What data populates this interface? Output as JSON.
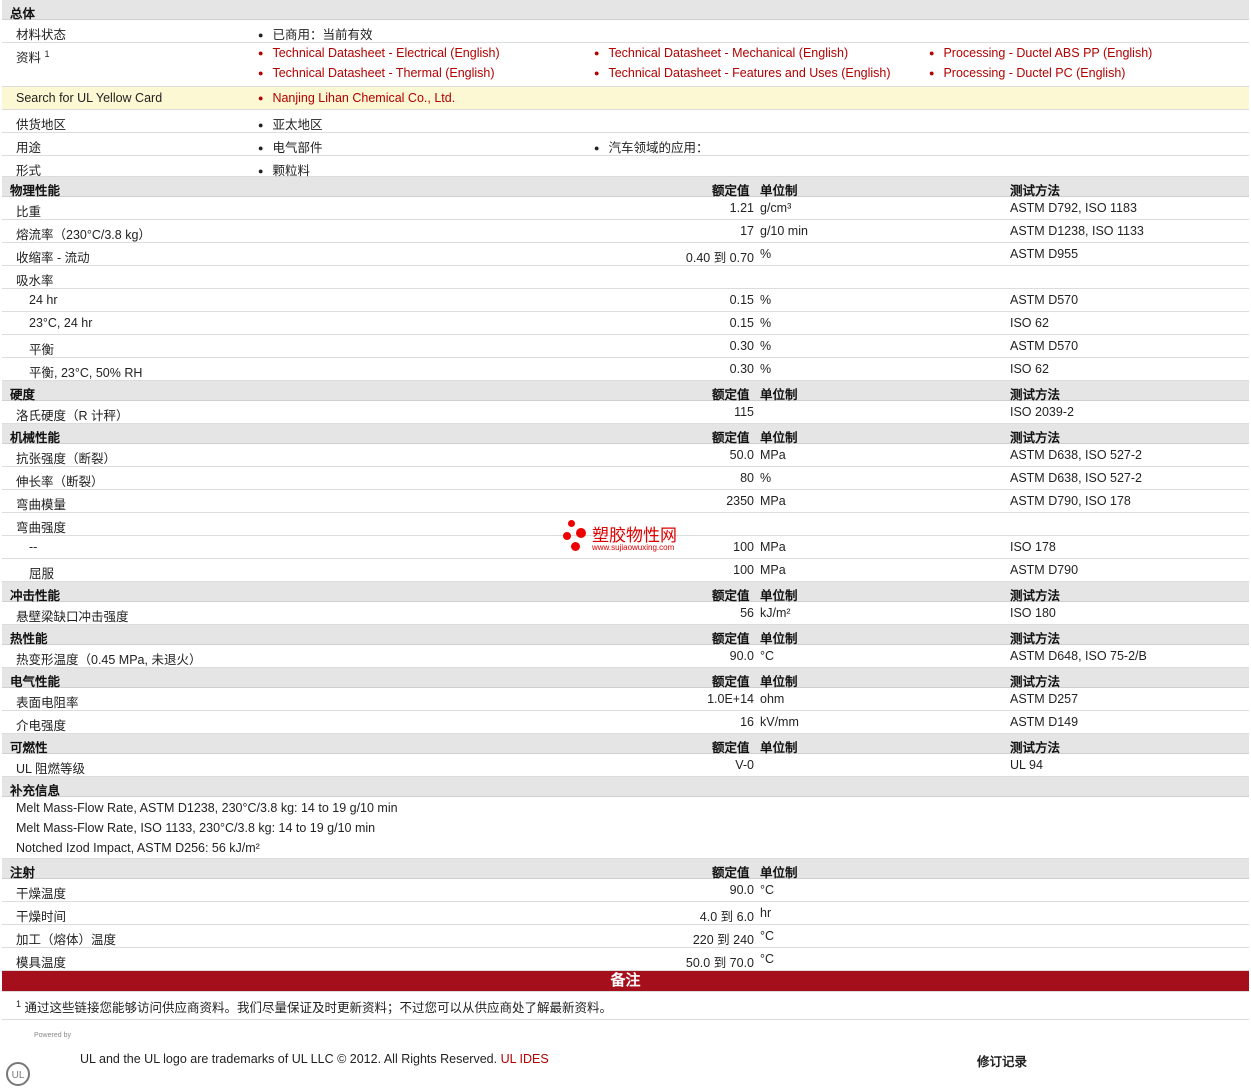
{
  "general": {
    "title": "总体",
    "status_label": "材料状态",
    "status_value": "已商用：当前有效",
    "docs_label": "资料",
    "docs_sup": "1",
    "docs": [
      "Technical Datasheet - Electrical (English)",
      "Technical Datasheet - Mechanical (English)",
      "Processing - Ductel ABS PP (English)",
      "Technical Datasheet - Thermal (English)",
      "Technical Datasheet - Features and Uses (English)",
      "Processing - Ductel PC (English)"
    ],
    "yellow_label": "Search for UL Yellow Card",
    "yellow_value": "Nanjing Lihan Chemical Co., Ltd.",
    "region_label": "供货地区",
    "region_value": "亚太地区",
    "use_label": "用途",
    "use_values": [
      "电气部件",
      "汽车领域的应用："
    ],
    "form_label": "形式",
    "form_value": "颗粒料"
  },
  "headers": {
    "value": "额定值",
    "unit": "单位制",
    "method": "测试方法"
  },
  "sections": [
    {
      "title": "物理性能",
      "rows": [
        {
          "label": "比重",
          "value": "1.21",
          "unit": "g/cm³",
          "method": "ASTM D792, ISO 1183"
        },
        {
          "label": "熔流率（230°C/3.8 kg）",
          "value": "17",
          "unit": "g/10 min",
          "method": "ASTM D1238, ISO 1133"
        },
        {
          "label": "收缩率 - 流动",
          "value": "0.40 到  0.70",
          "unit": "%",
          "method": "ASTM D955"
        },
        {
          "label": "吸水率",
          "value": "",
          "unit": "",
          "method": ""
        },
        {
          "label": "24 hr",
          "indent": true,
          "value": "0.15",
          "unit": "%",
          "method": "ASTM D570"
        },
        {
          "label": "23°C, 24 hr",
          "indent": true,
          "value": "0.15",
          "unit": "%",
          "method": "ISO 62"
        },
        {
          "label": "平衡",
          "indent": true,
          "value": "0.30",
          "unit": "%",
          "method": "ASTM D570"
        },
        {
          "label": "平衡, 23°C, 50% RH",
          "indent": true,
          "value": "0.30",
          "unit": "%",
          "method": "ISO 62"
        }
      ]
    },
    {
      "title": "硬度",
      "rows": [
        {
          "label": "洛氏硬度（R 计秤）",
          "value": "115",
          "unit": "",
          "method": "ISO 2039-2"
        }
      ]
    },
    {
      "title": "机械性能",
      "rows": [
        {
          "label": "抗张强度（断裂）",
          "value": "50.0",
          "unit": "MPa",
          "method": "ASTM D638, ISO 527-2"
        },
        {
          "label": "伸长率（断裂）",
          "value": "80",
          "unit": "%",
          "method": "ASTM D638, ISO 527-2"
        },
        {
          "label": "弯曲模量",
          "value": "2350",
          "unit": "MPa",
          "method": "ASTM D790, ISO 178"
        },
        {
          "label": "弯曲强度",
          "value": "",
          "unit": "",
          "method": ""
        },
        {
          "label": "--",
          "indent": true,
          "value": "100",
          "unit": "MPa",
          "method": "ISO 178"
        },
        {
          "label": "屈服",
          "indent": true,
          "value": "100",
          "unit": "MPa",
          "method": "ASTM D790"
        }
      ]
    },
    {
      "title": "冲击性能",
      "rows": [
        {
          "label": "悬壁梁缺口冲击强度",
          "value": "56",
          "unit": "kJ/m²",
          "method": "ISO 180"
        }
      ]
    },
    {
      "title": "热性能",
      "rows": [
        {
          "label": "热变形温度（0.45 MPa, 未退火）",
          "value": "90.0",
          "unit": "°C",
          "method": "ASTM D648, ISO 75-2/B"
        }
      ]
    },
    {
      "title": "电气性能",
      "rows": [
        {
          "label": "表面电阻率",
          "value": "1.0E+14",
          "unit": "ohm",
          "method": "ASTM D257"
        },
        {
          "label": "介电强度",
          "value": "16",
          "unit": "kV/mm",
          "method": "ASTM D149"
        }
      ]
    },
    {
      "title": "可燃性",
      "rows": [
        {
          "label": "UL 阻燃等级",
          "value": "V-0",
          "unit": "",
          "method": "UL 94"
        }
      ]
    }
  ],
  "supplement": {
    "title": "补充信息",
    "lines": [
      "Melt Mass-Flow Rate, ASTM D1238, 230°C/3.8 kg: 14 to 19 g/10 min",
      "Melt Mass-Flow Rate, ISO 1133, 230°C/3.8 kg: 14 to 19 g/10 min",
      "Notched Izod Impact, ASTM D256: 56 kJ/m²"
    ]
  },
  "injection": {
    "title": "注射",
    "rows": [
      {
        "label": "干燥温度",
        "value": "90.0",
        "unit": "°C"
      },
      {
        "label": "干燥时间",
        "value": "4.0 到  6.0",
        "unit": "hr"
      },
      {
        "label": "加工（熔体）温度",
        "value": "220 到  240",
        "unit": "°C"
      },
      {
        "label": "模具温度",
        "value": "50.0 到  70.0",
        "unit": "°C"
      }
    ]
  },
  "notes": {
    "title": "备注",
    "sup": "1",
    "text": "通过这些链接您能够访问供应商资料。我们尽量保证及时更新资料；不过您可以从供应商处了解最新资料。"
  },
  "footer": {
    "powered": "Powered by",
    "text": "UL and the UL logo are trademarks of UL LLC © 2012. All Rights Reserved.",
    "link": "UL IDES",
    "revision": "修订记录"
  },
  "watermark": {
    "title": "塑胶物性网",
    "url": "www.sujiaowuxing.com"
  }
}
